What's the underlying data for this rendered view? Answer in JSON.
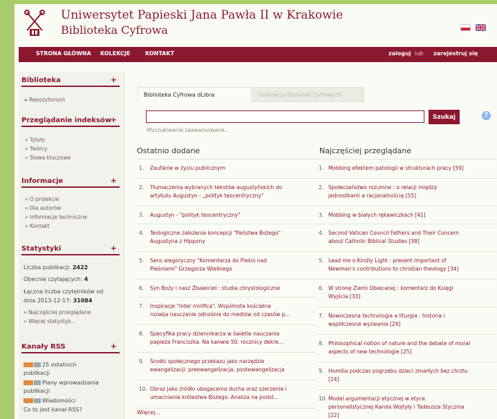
{
  "header": {
    "title_line1": "Uniwersytet Papieski Jana Pawła II w Krakowie",
    "title_line2": "Biblioteka Cyfrowa"
  },
  "nav": {
    "items": [
      "STRONA GŁÓWNA",
      "KOLEKCJE",
      "KONTAKT"
    ],
    "login": "zaloguj",
    "or": "lub",
    "register": "zarejestruj się"
  },
  "sidebar": {
    "biblioteka": {
      "title": "Biblioteka",
      "toggle": "+",
      "items": [
        "Repozytorium"
      ]
    },
    "indeksy": {
      "title": "Przeglądanie indeksów",
      "toggle": "+",
      "items": [
        "Tytuły",
        "Twórcy",
        "Słowa kluczowe"
      ]
    },
    "informacje": {
      "title": "Informacje",
      "toggle": "+",
      "items": [
        "O projekcie",
        "Dla autorów",
        "Informacje techniczne",
        "Kontakt"
      ]
    },
    "statystyki": {
      "title": "Statystyki",
      "toggle": "+",
      "pub_label": "Liczba publikacji:",
      "pub_value": "2422",
      "now_label": "Obecnie czytających:",
      "now_value": "4",
      "total_label_1": "Łączna liczba czytelników od",
      "total_label_2": "dnia 2013-12-17:",
      "total_value": "31084",
      "links": [
        "Najczęściej przeglądane",
        "Więcej statystyk..."
      ]
    },
    "rss": {
      "title": "Kanały RSS",
      "toggle": "+",
      "items": [
        [
          "25 ostatnich",
          "publikacji"
        ],
        [
          "Plany wprowadzania",
          "publikacji"
        ],
        [
          "Wiadomości"
        ]
      ],
      "what": "Co to jest kanał RSS?"
    }
  },
  "main": {
    "tabs": [
      "Biblioteka Cyfrowa dLibra",
      "Federacja Bibliotek Cyfrowych"
    ],
    "search": {
      "value": "",
      "button": "Szukaj",
      "help": "?",
      "advanced": "Wyszukiwanie zaawansowane..."
    },
    "recent": {
      "title": "Ostatnio dodane",
      "items": [
        {
          "num": "1.",
          "lines": [
            "Zaufanie w życiu publicznym"
          ]
        },
        {
          "num": "2.",
          "lines": [
            "Tłumaczenia wybranych tekstów augustyńskich do",
            "artykułu Augustyn - „polityk teocentryczny\""
          ]
        },
        {
          "num": "3.",
          "lines": [
            "Augustyn - \"polityk teocentryczny\""
          ]
        },
        {
          "num": "4.",
          "lines": [
            "Teologiczne założenia koncepcji \"Państwa Bożego\"",
            "Augustyna z Hippony"
          ]
        },
        {
          "num": "5.",
          "lines": [
            "Sens alegoryczny \"Komentarza do Pieśni nad",
            "Pieśniami\" Grzegorza Wielkiego"
          ]
        },
        {
          "num": "6.",
          "lines": [
            "Syn Boży i nasz Zbawiciel : studia chrystologiczne"
          ]
        },
        {
          "num": "7.",
          "lines": [
            "Inspiracje \"Inter mirifica\". Wspólnota kościelna",
            "rozwija nauczanie odnośnie do mediów od czasów p..."
          ]
        },
        {
          "num": "8.",
          "lines": [
            "Specyfika pracy dziennikarza w świetle nauczania",
            "papieża Franciszka. Na kanwie 50. rocznicy dekre..."
          ]
        },
        {
          "num": "9.",
          "lines": [
            "Środki społecznego przekazu jako narzędzie",
            "ewangelizacji: preewangelizacja, postewangelizacja"
          ]
        },
        {
          "num": "10.",
          "lines": [
            "Obraz jako źródło ubogacenia ducha oraz szerzenie i",
            "umacniania królestwa Bożego. Analiza na podst..."
          ]
        }
      ],
      "more": "Więcej..."
    },
    "popular": {
      "title": "Najczęściej przeglądane",
      "items": [
        {
          "num": "1.",
          "lines": [
            "Mobbing efektem patologii w strukturach pracy [59]"
          ]
        },
        {
          "num": "2.",
          "lines": [
            "Społeczeństwo rozumne : o relacji między",
            "jednostkami a racjonalnością [55]"
          ]
        },
        {
          "num": "3.",
          "lines": [
            "Mobbing w białych rękawiczkach [41]"
          ]
        },
        {
          "num": "4.",
          "lines": [
            "Second Vatican Council Fathers and Their Concern",
            "about Catholic Biblical Studies [38]"
          ]
        },
        {
          "num": "5.",
          "lines": [
            "Lead me o Kindly Light : present important of",
            "Newman's contributions to christian theology [34]"
          ]
        },
        {
          "num": "6.",
          "lines": [
            "W stronę Ziemi Obiecanej : komentarz do Księgi",
            "Wyjścia [33]"
          ]
        },
        {
          "num": "7.",
          "lines": [
            "Nowoczesna technologia a liturgia : historia i",
            "współczesne wyzwania [29]"
          ]
        },
        {
          "num": "8.",
          "lines": [
            "Philosophical notion of nature and the debate of moral",
            "aspects of new technologie [25]"
          ]
        },
        {
          "num": "9.",
          "lines": [
            "Homilia podczas pogrzebu dzieci zmarłych bez chrztu",
            "[24]"
          ]
        },
        {
          "num": "10.",
          "lines": [
            "Model argumentacji etycznej w etyce",
            "personalistycznej Karola Wojtyły i Tadeusza Stycznia",
            "[22]"
          ]
        }
      ]
    }
  },
  "colors": {
    "brand": "#8c1830",
    "frame": "#a9cc6b"
  }
}
